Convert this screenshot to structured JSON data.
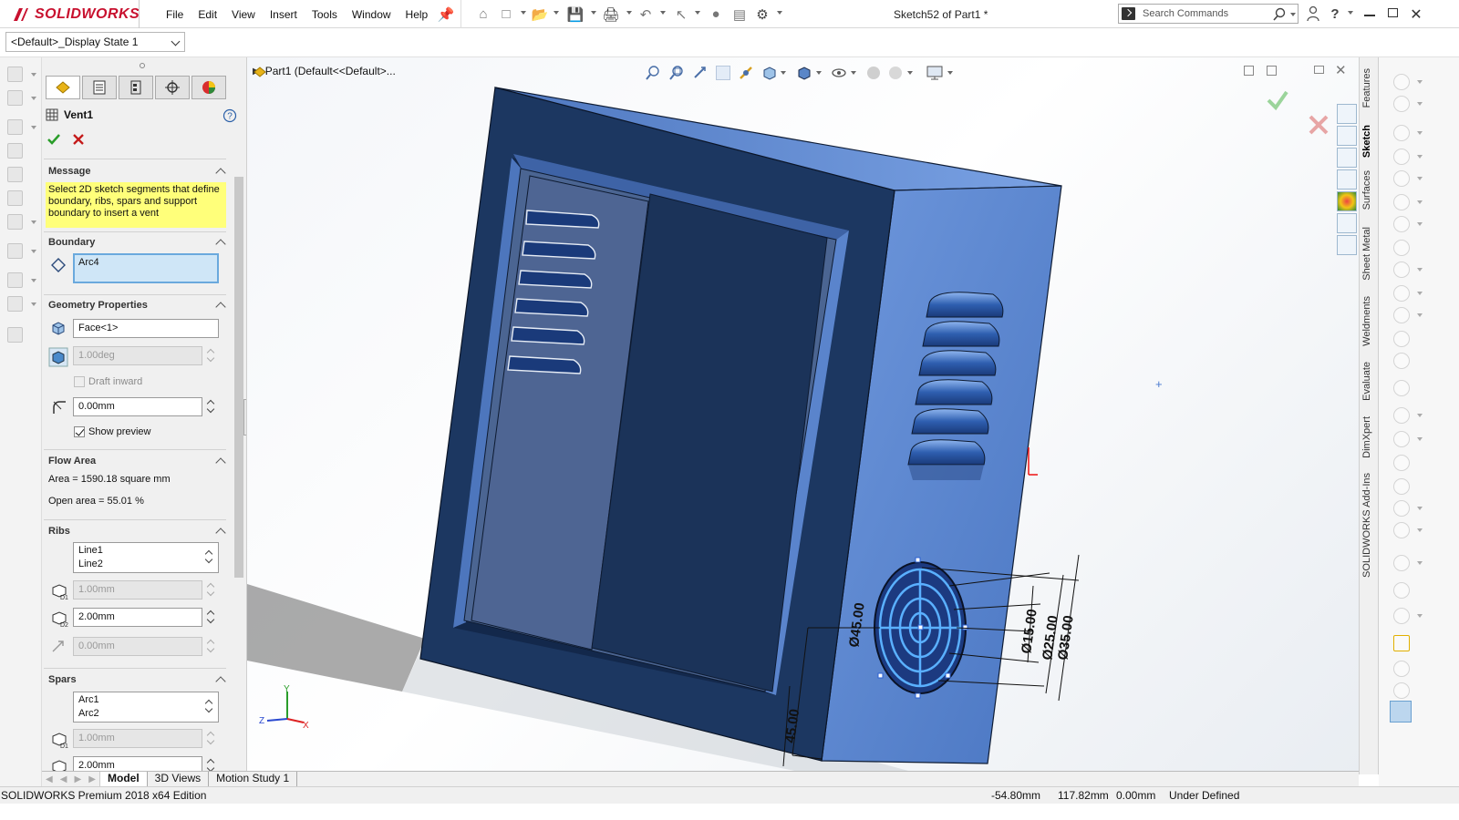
{
  "app": {
    "brand": "SOLIDWORKS",
    "menu": [
      "File",
      "Edit",
      "View",
      "Insert",
      "Tools",
      "Window",
      "Help"
    ],
    "document_title": "Sketch52 of Part1 *",
    "search_placeholder": "Search Commands"
  },
  "config": {
    "display_state": "<Default>_Display State 1"
  },
  "feature_tree": {
    "breadcrumb": "Part1  (Default<<Default>..."
  },
  "property_manager": {
    "title": "Vent1",
    "message": {
      "header": "Message",
      "text": "Select 2D sketch segments that define boundary, ribs, spars and support boundary to insert a vent"
    },
    "boundary": {
      "header": "Boundary",
      "value": "Arc4"
    },
    "geometry_properties": {
      "header": "Geometry Properties",
      "face": "Face<1>",
      "draft_angle": "1.00deg",
      "draft_inward_label": "Draft inward",
      "draft_inward_checked": false,
      "fillet_radius": "0.00mm",
      "show_preview_label": "Show preview",
      "show_preview_checked": true
    },
    "flow_area": {
      "header": "Flow Area",
      "area": "Area = 1590.18 square mm",
      "open_area": "Open area = 55.01 %"
    },
    "ribs": {
      "header": "Ribs",
      "items": [
        "Line1",
        "Line2"
      ],
      "depth": "1.00mm",
      "width": "2.00mm",
      "offset": "0.00mm"
    },
    "spars": {
      "header": "Spars",
      "items": [
        "Arc1",
        "Arc2"
      ],
      "depth": "1.00mm",
      "width": "2.00mm"
    }
  },
  "viewport": {
    "dimensions": [
      "Ø45.00",
      "Ø15.00",
      "Ø25.00",
      "Ø35.00",
      "45.00"
    ],
    "triad": {
      "x": "X",
      "y": "Y",
      "z": "Z"
    },
    "colors": {
      "body_front": "#1e3a66",
      "body_side": "#5b86cc",
      "body_top": "#6a93d8",
      "accent": "#5ab0ff"
    }
  },
  "task_pane": {
    "tabs": [
      "Features",
      "Sketch",
      "Surfaces",
      "Sheet Metal",
      "Weldments",
      "Evaluate",
      "DimXpert",
      "SOLIDWORKS Add-Ins"
    ],
    "active_tab": "Sketch"
  },
  "bottom_tabs": [
    "Model",
    "3D Views",
    "Motion Study 1"
  ],
  "status_bar": {
    "edition": "SOLIDWORKS Premium 2018 x64 Edition",
    "x": "-54.80mm",
    "y": "117.82mm",
    "z": "0.00mm",
    "state": "Under Defined"
  }
}
